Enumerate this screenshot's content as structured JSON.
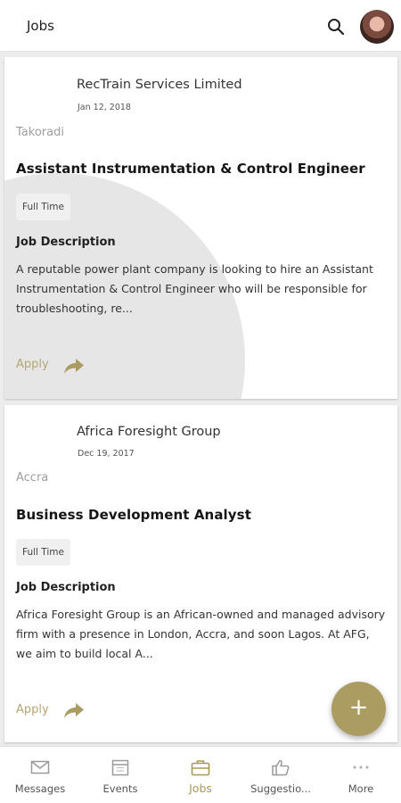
{
  "header": {
    "title": "Jobs"
  },
  "jobs": [
    {
      "company": "RecTrain Services Limited",
      "date": "Jan 12, 2018",
      "location": "Takoradi",
      "title": "Assistant Instrumentation & Control Engineer",
      "type": "Full Time",
      "desc_heading": "Job Description",
      "description": "A reputable power plant company is looking to hire an Assistant Instrumentation & Control Engineer who will be responsible for troubleshooting, re...",
      "apply_label": "Apply"
    },
    {
      "company": "Africa Foresight Group",
      "date": "Dec 19, 2017",
      "location": "Accra",
      "title": "Business Development Analyst",
      "type": "Full Time",
      "desc_heading": "Job Description",
      "description": "Africa Foresight Group is an African-owned and managed advisory firm with a presence in London, Accra, and soon Lagos. At AFG, we aim to build local A...",
      "apply_label": "Apply"
    }
  ],
  "fab": {
    "label": "+"
  },
  "bottom_nav": [
    {
      "label": "Messages",
      "icon": "mail-icon"
    },
    {
      "label": "Events",
      "icon": "calendar-icon"
    },
    {
      "label": "Jobs",
      "icon": "briefcase-icon",
      "active": true
    },
    {
      "label": "Suggestio...",
      "icon": "thumbs-up-icon"
    },
    {
      "label": "More",
      "icon": "more-dots-icon"
    }
  ],
  "colors": {
    "accent": "#ab9d62",
    "accent_text": "#b3a674",
    "background": "#ececec"
  }
}
